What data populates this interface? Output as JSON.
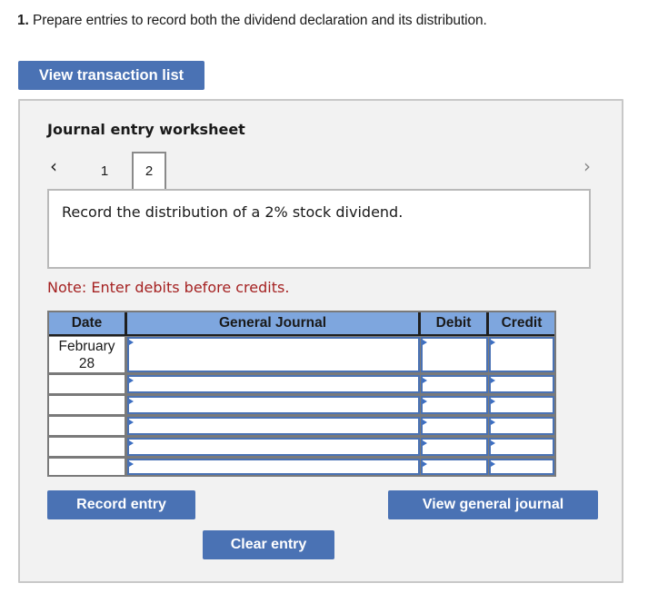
{
  "instruction": {
    "number": "1.",
    "text": "Prepare entries to record both the dividend declaration and its distribution."
  },
  "buttons": {
    "view_transaction_list": "View transaction list",
    "record_entry": "Record entry",
    "clear_entry": "Clear entry",
    "view_general_journal": "View general journal"
  },
  "worksheet": {
    "title": "Journal entry worksheet",
    "nav": {
      "prev_icon": "‹",
      "next_icon": "›",
      "pages": [
        "1",
        "2"
      ],
      "active_page": "2"
    },
    "prompt": "Record the distribution of a 2% stock dividend.",
    "note": "Note: Enter debits before credits.",
    "table": {
      "headers": {
        "date": "Date",
        "general_journal": "General Journal",
        "debit": "Debit",
        "credit": "Credit"
      },
      "rows": [
        {
          "date_line1": "February",
          "date_line2": "28",
          "account": "",
          "debit": "",
          "credit": ""
        },
        {
          "date_line1": "",
          "date_line2": "",
          "account": "",
          "debit": "",
          "credit": ""
        },
        {
          "date_line1": "",
          "date_line2": "",
          "account": "",
          "debit": "",
          "credit": ""
        },
        {
          "date_line1": "",
          "date_line2": "",
          "account": "",
          "debit": "",
          "credit": ""
        },
        {
          "date_line1": "",
          "date_line2": "",
          "account": "",
          "debit": "",
          "credit": ""
        },
        {
          "date_line1": "",
          "date_line2": "",
          "account": "",
          "debit": "",
          "credit": ""
        }
      ]
    }
  },
  "colors": {
    "button_blue": "#4a72b4",
    "header_blue": "#7ea6de",
    "note_red": "#a52222",
    "panel_bg": "#f2f2f2"
  }
}
